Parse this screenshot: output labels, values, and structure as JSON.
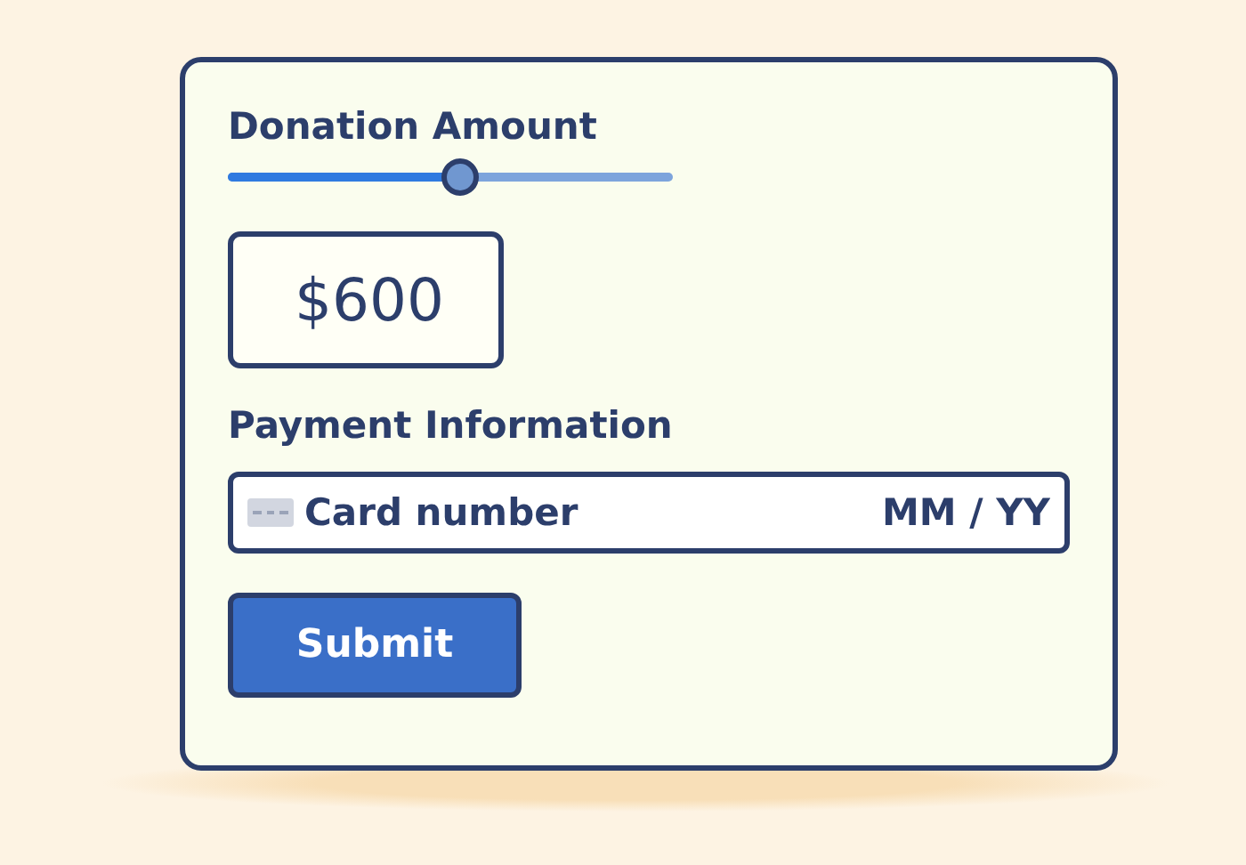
{
  "donation": {
    "label": "Donation Amount",
    "slider": {
      "level": 0.52
    },
    "amount": "$600"
  },
  "payment": {
    "label": "Payment Information",
    "card_field": {
      "placeholder": "Card number"
    },
    "expiry_field": {
      "placeholder": "MM / YY"
    }
  },
  "buttons": [
    {
      "label": "Submit"
    }
  ]
}
